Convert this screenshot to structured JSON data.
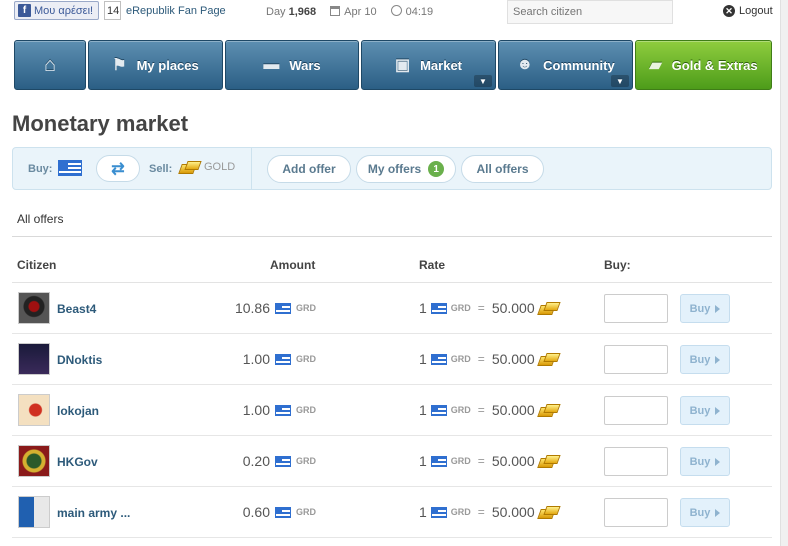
{
  "topbar": {
    "like_label": "Μου αρέσει!",
    "like_count": "14",
    "fan_page": "eRepublik Fan Page",
    "day_label": "Day",
    "day_value": "1,968",
    "date": "Apr 10",
    "time": "04:19",
    "search_placeholder": "Search citizen",
    "logout": "Logout"
  },
  "nav": {
    "my_places": "My places",
    "wars": "Wars",
    "market": "Market",
    "community": "Community",
    "gold": "Gold & Extras"
  },
  "page": {
    "title": "Monetary market"
  },
  "toolbar": {
    "buy_label": "Buy:",
    "sell_label": "Sell:",
    "sell_currency": "GOLD",
    "add_offer": "Add offer",
    "my_offers": "My offers",
    "my_offers_count": "1",
    "all_offers": "All offers"
  },
  "section": {
    "label": "All offers"
  },
  "table": {
    "headers": {
      "citizen": "Citizen",
      "amount": "Amount",
      "rate": "Rate",
      "buy": "Buy:"
    },
    "rows": [
      {
        "citizen": "Beast4",
        "amount": "10.86",
        "currency": "GRD",
        "rate_qty": "1",
        "rate_value": "50.000",
        "buy_label": "Buy"
      },
      {
        "citizen": "DNoktis",
        "amount": "1.00",
        "currency": "GRD",
        "rate_qty": "1",
        "rate_value": "50.000",
        "buy_label": "Buy"
      },
      {
        "citizen": "lokojan",
        "amount": "1.00",
        "currency": "GRD",
        "rate_qty": "1",
        "rate_value": "50.000",
        "buy_label": "Buy"
      },
      {
        "citizen": "HKGov",
        "amount": "0.20",
        "currency": "GRD",
        "rate_qty": "1",
        "rate_value": "50.000",
        "buy_label": "Buy"
      },
      {
        "citizen": "main army ...",
        "amount": "0.60",
        "currency": "GRD",
        "rate_qty": "1",
        "rate_value": "50.000",
        "buy_label": "Buy"
      }
    ]
  },
  "colors": {
    "nav_blue": "#2b5f85",
    "nav_green": "#4d9c1a",
    "link": "#2d5a7a",
    "toolbar_bg": "#eaf4fa"
  }
}
